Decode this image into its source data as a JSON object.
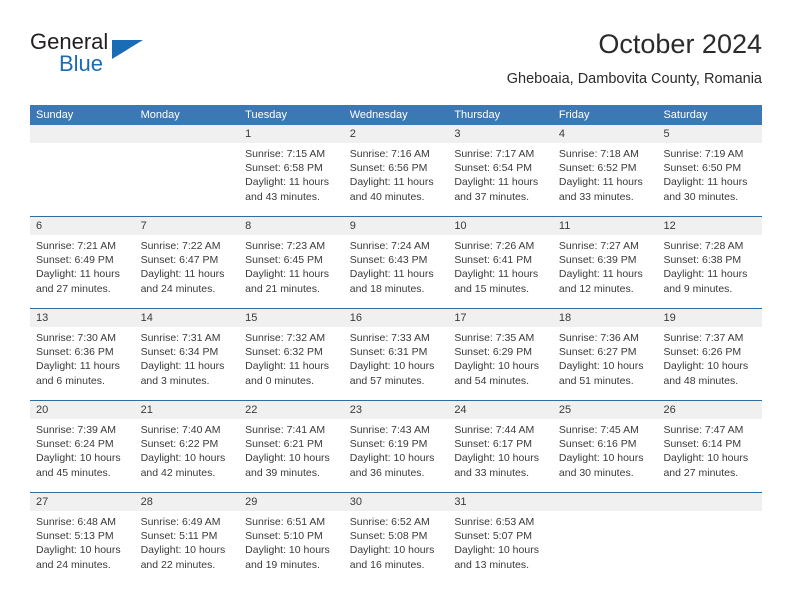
{
  "brand": {
    "name_top": "General",
    "name_bottom": "Blue",
    "flag_icon": "triangle-flag-icon",
    "accent_color": "#1a6cb4"
  },
  "header": {
    "title": "October 2024",
    "subtitle": "Gheboaia, Dambovita County, Romania"
  },
  "calendar": {
    "header_bg": "#3c78b4",
    "date_band_bg": "#f0f0f0",
    "separator_color": "#2e6da4",
    "weekdays": [
      "Sunday",
      "Monday",
      "Tuesday",
      "Wednesday",
      "Thursday",
      "Friday",
      "Saturday"
    ],
    "weeks": [
      [
        {
          "day": "",
          "sunrise": "",
          "sunset": "",
          "daylight_1": "",
          "daylight_2": ""
        },
        {
          "day": "",
          "sunrise": "",
          "sunset": "",
          "daylight_1": "",
          "daylight_2": ""
        },
        {
          "day": "1",
          "sunrise": "Sunrise: 7:15 AM",
          "sunset": "Sunset: 6:58 PM",
          "daylight_1": "Daylight: 11 hours",
          "daylight_2": "and 43 minutes."
        },
        {
          "day": "2",
          "sunrise": "Sunrise: 7:16 AM",
          "sunset": "Sunset: 6:56 PM",
          "daylight_1": "Daylight: 11 hours",
          "daylight_2": "and 40 minutes."
        },
        {
          "day": "3",
          "sunrise": "Sunrise: 7:17 AM",
          "sunset": "Sunset: 6:54 PM",
          "daylight_1": "Daylight: 11 hours",
          "daylight_2": "and 37 minutes."
        },
        {
          "day": "4",
          "sunrise": "Sunrise: 7:18 AM",
          "sunset": "Sunset: 6:52 PM",
          "daylight_1": "Daylight: 11 hours",
          "daylight_2": "and 33 minutes."
        },
        {
          "day": "5",
          "sunrise": "Sunrise: 7:19 AM",
          "sunset": "Sunset: 6:50 PM",
          "daylight_1": "Daylight: 11 hours",
          "daylight_2": "and 30 minutes."
        }
      ],
      [
        {
          "day": "6",
          "sunrise": "Sunrise: 7:21 AM",
          "sunset": "Sunset: 6:49 PM",
          "daylight_1": "Daylight: 11 hours",
          "daylight_2": "and 27 minutes."
        },
        {
          "day": "7",
          "sunrise": "Sunrise: 7:22 AM",
          "sunset": "Sunset: 6:47 PM",
          "daylight_1": "Daylight: 11 hours",
          "daylight_2": "and 24 minutes."
        },
        {
          "day": "8",
          "sunrise": "Sunrise: 7:23 AM",
          "sunset": "Sunset: 6:45 PM",
          "daylight_1": "Daylight: 11 hours",
          "daylight_2": "and 21 minutes."
        },
        {
          "day": "9",
          "sunrise": "Sunrise: 7:24 AM",
          "sunset": "Sunset: 6:43 PM",
          "daylight_1": "Daylight: 11 hours",
          "daylight_2": "and 18 minutes."
        },
        {
          "day": "10",
          "sunrise": "Sunrise: 7:26 AM",
          "sunset": "Sunset: 6:41 PM",
          "daylight_1": "Daylight: 11 hours",
          "daylight_2": "and 15 minutes."
        },
        {
          "day": "11",
          "sunrise": "Sunrise: 7:27 AM",
          "sunset": "Sunset: 6:39 PM",
          "daylight_1": "Daylight: 11 hours",
          "daylight_2": "and 12 minutes."
        },
        {
          "day": "12",
          "sunrise": "Sunrise: 7:28 AM",
          "sunset": "Sunset: 6:38 PM",
          "daylight_1": "Daylight: 11 hours",
          "daylight_2": "and 9 minutes."
        }
      ],
      [
        {
          "day": "13",
          "sunrise": "Sunrise: 7:30 AM",
          "sunset": "Sunset: 6:36 PM",
          "daylight_1": "Daylight: 11 hours",
          "daylight_2": "and 6 minutes."
        },
        {
          "day": "14",
          "sunrise": "Sunrise: 7:31 AM",
          "sunset": "Sunset: 6:34 PM",
          "daylight_1": "Daylight: 11 hours",
          "daylight_2": "and 3 minutes."
        },
        {
          "day": "15",
          "sunrise": "Sunrise: 7:32 AM",
          "sunset": "Sunset: 6:32 PM",
          "daylight_1": "Daylight: 11 hours",
          "daylight_2": "and 0 minutes."
        },
        {
          "day": "16",
          "sunrise": "Sunrise: 7:33 AM",
          "sunset": "Sunset: 6:31 PM",
          "daylight_1": "Daylight: 10 hours",
          "daylight_2": "and 57 minutes."
        },
        {
          "day": "17",
          "sunrise": "Sunrise: 7:35 AM",
          "sunset": "Sunset: 6:29 PM",
          "daylight_1": "Daylight: 10 hours",
          "daylight_2": "and 54 minutes."
        },
        {
          "day": "18",
          "sunrise": "Sunrise: 7:36 AM",
          "sunset": "Sunset: 6:27 PM",
          "daylight_1": "Daylight: 10 hours",
          "daylight_2": "and 51 minutes."
        },
        {
          "day": "19",
          "sunrise": "Sunrise: 7:37 AM",
          "sunset": "Sunset: 6:26 PM",
          "daylight_1": "Daylight: 10 hours",
          "daylight_2": "and 48 minutes."
        }
      ],
      [
        {
          "day": "20",
          "sunrise": "Sunrise: 7:39 AM",
          "sunset": "Sunset: 6:24 PM",
          "daylight_1": "Daylight: 10 hours",
          "daylight_2": "and 45 minutes."
        },
        {
          "day": "21",
          "sunrise": "Sunrise: 7:40 AM",
          "sunset": "Sunset: 6:22 PM",
          "daylight_1": "Daylight: 10 hours",
          "daylight_2": "and 42 minutes."
        },
        {
          "day": "22",
          "sunrise": "Sunrise: 7:41 AM",
          "sunset": "Sunset: 6:21 PM",
          "daylight_1": "Daylight: 10 hours",
          "daylight_2": "and 39 minutes."
        },
        {
          "day": "23",
          "sunrise": "Sunrise: 7:43 AM",
          "sunset": "Sunset: 6:19 PM",
          "daylight_1": "Daylight: 10 hours",
          "daylight_2": "and 36 minutes."
        },
        {
          "day": "24",
          "sunrise": "Sunrise: 7:44 AM",
          "sunset": "Sunset: 6:17 PM",
          "daylight_1": "Daylight: 10 hours",
          "daylight_2": "and 33 minutes."
        },
        {
          "day": "25",
          "sunrise": "Sunrise: 7:45 AM",
          "sunset": "Sunset: 6:16 PM",
          "daylight_1": "Daylight: 10 hours",
          "daylight_2": "and 30 minutes."
        },
        {
          "day": "26",
          "sunrise": "Sunrise: 7:47 AM",
          "sunset": "Sunset: 6:14 PM",
          "daylight_1": "Daylight: 10 hours",
          "daylight_2": "and 27 minutes."
        }
      ],
      [
        {
          "day": "27",
          "sunrise": "Sunrise: 6:48 AM",
          "sunset": "Sunset: 5:13 PM",
          "daylight_1": "Daylight: 10 hours",
          "daylight_2": "and 24 minutes."
        },
        {
          "day": "28",
          "sunrise": "Sunrise: 6:49 AM",
          "sunset": "Sunset: 5:11 PM",
          "daylight_1": "Daylight: 10 hours",
          "daylight_2": "and 22 minutes."
        },
        {
          "day": "29",
          "sunrise": "Sunrise: 6:51 AM",
          "sunset": "Sunset: 5:10 PM",
          "daylight_1": "Daylight: 10 hours",
          "daylight_2": "and 19 minutes."
        },
        {
          "day": "30",
          "sunrise": "Sunrise: 6:52 AM",
          "sunset": "Sunset: 5:08 PM",
          "daylight_1": "Daylight: 10 hours",
          "daylight_2": "and 16 minutes."
        },
        {
          "day": "31",
          "sunrise": "Sunrise: 6:53 AM",
          "sunset": "Sunset: 5:07 PM",
          "daylight_1": "Daylight: 10 hours",
          "daylight_2": "and 13 minutes."
        },
        {
          "day": "",
          "sunrise": "",
          "sunset": "",
          "daylight_1": "",
          "daylight_2": ""
        },
        {
          "day": "",
          "sunrise": "",
          "sunset": "",
          "daylight_1": "",
          "daylight_2": ""
        }
      ]
    ]
  }
}
